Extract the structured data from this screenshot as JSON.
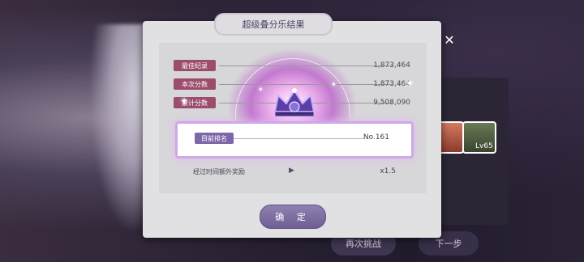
{
  "dialog": {
    "title": "超级叠分乐结果",
    "rows": [
      {
        "label": "最佳纪录",
        "value": "1,873,464"
      },
      {
        "label": "本次分数",
        "value": "1,873,464"
      },
      {
        "label": "累计分数",
        "value": "9,508,090"
      }
    ],
    "rank": {
      "label": "目前排名",
      "value": "No.161"
    },
    "bonus": {
      "label": "经过时间额外奖励",
      "value": "x1.5"
    },
    "confirm_label": "确 定"
  },
  "background": {
    "retry_label": "再次挑战",
    "next_label": "下一步",
    "card_level": "Lv65"
  },
  "colors": {
    "row_label_bg": "#9c4d6e",
    "rank_label_bg": "#7e67a9",
    "confirm_button": "#7d6da3"
  }
}
